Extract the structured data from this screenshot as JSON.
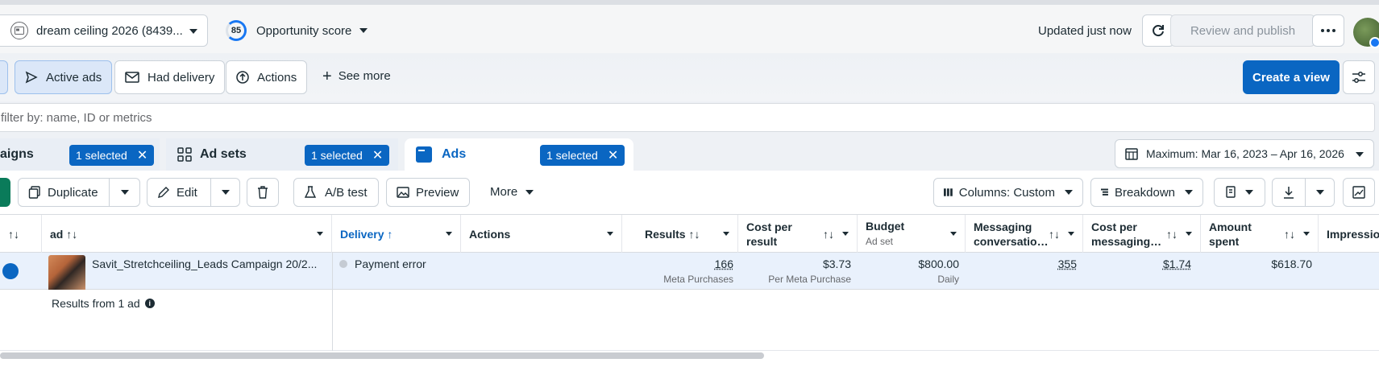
{
  "header": {
    "account_label": "dream ceiling 2026 (8439...",
    "opportunity_score": "85",
    "opportunity_label": "Opportunity score",
    "updated_text": "Updated just now",
    "review_label": "Review and publish"
  },
  "filters": {
    "active_ads": "Active ads",
    "had_delivery": "Had delivery",
    "actions": "Actions",
    "see_more": "See more",
    "create_view": "Create a view"
  },
  "search": {
    "placeholder": "filter by: name, ID or metrics"
  },
  "tabs": {
    "campaigns": "aigns",
    "campaigns_selected": "1 selected",
    "adsets": "Ad sets",
    "adsets_selected": "1 selected",
    "ads": "Ads",
    "ads_selected": "1 selected",
    "date_range": "Maximum: Mar 16, 2023 – Apr 16, 2026"
  },
  "toolbar": {
    "duplicate": "Duplicate",
    "edit": "Edit",
    "ab_test": "A/B test",
    "preview": "Preview",
    "more": "More",
    "columns": "Columns: Custom",
    "breakdown": "Breakdown"
  },
  "columns": {
    "sort": "↑↓",
    "ad": "ad ↑↓",
    "delivery": "Delivery ↑",
    "actions": "Actions",
    "results": "Results ↑↓",
    "cost_per_result_1": "Cost per",
    "cost_per_result_2": "result",
    "budget": "Budget",
    "budget_sub": "Ad set",
    "messaging_1": "Messaging",
    "messaging_2": "conversatio…",
    "cost_msg_1": "Cost per",
    "cost_msg_2": "messaging…",
    "amount_1": "Amount",
    "amount_2": "spent",
    "impressions": "Impressio"
  },
  "row": {
    "ad_name": "Savit_Stretchceiling_Leads Campaign 20/2...",
    "delivery": "Payment error",
    "results": "166",
    "results_sub": "Meta Purchases",
    "cost_per_result": "$3.73",
    "cost_per_result_sub": "Per Meta Purchase",
    "budget": "$800.00",
    "budget_sub": "Daily",
    "messaging": "355",
    "cost_msg": "$1.74",
    "amount_spent": "$618.70"
  },
  "summary": {
    "results_from": "Results from 1 ad"
  }
}
